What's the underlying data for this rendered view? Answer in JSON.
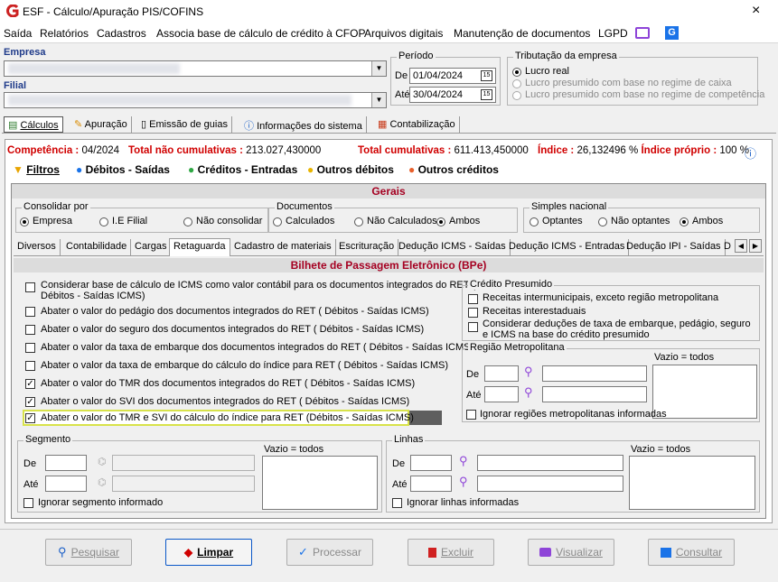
{
  "window": {
    "title": "ESF - Cálculo/Apuração PIS/COFINS",
    "close_glyph": "×"
  },
  "menu": [
    "Saída",
    "Relatórios",
    "Cadastros",
    "Associa base de cálculo de crédito à CFOP",
    "Arquivos digitais",
    "Manutenção de documentos",
    "LGPD"
  ],
  "empresa": {
    "label": "Empresa",
    "value": ""
  },
  "filial": {
    "label": "Filial",
    "value": ""
  },
  "periodo": {
    "title": "Período",
    "de_label": "De",
    "de_value": "01/04/2024",
    "ate_label": "Até",
    "ate_value": "30/04/2024",
    "cal_glyph": "15"
  },
  "tributacao": {
    "title": "Tributação da empresa",
    "options": [
      "Lucro real",
      "Lucro presumido com base no regime de caixa",
      "Lucro presumido com base no regime de competência"
    ],
    "selected": 0
  },
  "main_tabs": [
    "Cálculos",
    "Apuração",
    "Emissão de guias",
    "Informações do sistema",
    "Contabilização"
  ],
  "summary": {
    "competencia_label": "Competência :",
    "competencia_value": "04/2024",
    "nao_cum_label": "Total não cumulativas :",
    "nao_cum_value": "213.027,430000",
    "cum_label": "Total cumulativas :",
    "cum_value": "611.413,450000",
    "indice_label": "Índice :",
    "indice_value": "26,132496 %",
    "indice_proprio_label": "Índice próprio :",
    "indice_proprio_value": "100 %"
  },
  "sub_tabs": [
    "Filtros",
    "Débitos - Saídas",
    "Créditos - Entradas",
    "Outros débitos",
    "Outros créditos"
  ],
  "gerais": {
    "title": "Gerais",
    "consolidar": {
      "title": "Consolidar por",
      "options": [
        "Empresa",
        "I.E Filial",
        "Não consolidar"
      ],
      "selected": 0
    },
    "documentos": {
      "title": "Documentos",
      "options": [
        "Calculados",
        "Não Calculados",
        "Ambos"
      ],
      "selected": 2
    },
    "simples": {
      "title": "Simples nacional",
      "options": [
        "Optantes",
        "Não optantes",
        "Ambos"
      ],
      "selected": 2
    }
  },
  "filter_tabs": [
    "Diversos",
    "Contabilidade",
    "Cargas",
    "Retaguarda",
    "Cadastro de materiais",
    "Escrituração",
    "Dedução ICMS - Saídas",
    "Dedução ICMS - Entradas",
    "Dedução IPI - Saídas",
    "D"
  ],
  "bpe": {
    "title": "Bilhete de Passagem Eletrônico (BPe)",
    "options": [
      {
        "label": "Considerar base de cálculo de ICMS como valor contábil para os documentos integrados do RET (",
        "label2": "Débitos - Saídas ICMS)",
        "checked": false
      },
      {
        "label": "Abater o valor do pedágio dos documentos integrados do RET ( Débitos - Saídas ICMS)",
        "checked": false
      },
      {
        "label": "Abater o valor do seguro dos documentos integrados do RET ( Débitos - Saídas ICMS)",
        "checked": false
      },
      {
        "label": "Abater o valor da taxa de embarque dos documentos integrados do RET ( Débitos - Saídas ICMS)",
        "checked": false
      },
      {
        "label": "Abater o valor da taxa de embarque do cálculo do índice para RET ( Débitos - Saídas ICMS)",
        "checked": false
      },
      {
        "label": "Abater o valor do TMR dos documentos integrados do RET ( Débitos - Saídas ICMS)",
        "checked": true
      },
      {
        "label": "Abater o valor do SVI dos documentos integrados do RET ( Débitos - Saídas ICMS)",
        "checked": true
      },
      {
        "label": "Abater o valor do TMR e SVI do cálculo do índice para RET (Débitos - Saídas ICMS)",
        "checked": true
      }
    ]
  },
  "credito_presumido": {
    "title": "Crédito Presumido",
    "options": [
      {
        "label": "Receitas intermunicipais, exceto região metropolitana",
        "checked": false
      },
      {
        "label": "Receitas interestaduais",
        "checked": false
      },
      {
        "label": "Considerar deduções de taxa de embarque, pedágio, seguro",
        "label2": "e ICMS na base do crédito presumido",
        "checked": false
      }
    ]
  },
  "regiao": {
    "title": "Região Metropolitana",
    "vazio": "Vazio = todos",
    "de_label": "De",
    "ate_label": "Até",
    "ignorar": "Ignorar regiões metropolitanas informadas"
  },
  "segmento": {
    "title": "Segmento",
    "vazio": "Vazio = todos",
    "de_label": "De",
    "ate_label": "Até",
    "ignorar": "Ignorar segmento informado"
  },
  "linhas": {
    "title": "Linhas",
    "vazio": "Vazio = todos",
    "de_label": "De",
    "ate_label": "Até",
    "ignorar": "Ignorar linhas informadas"
  },
  "buttons": [
    "Pesquisar",
    "Limpar",
    "Processar",
    "Excluir",
    "Visualizar",
    "Consultar"
  ],
  "colors": {
    "accent_red": "#d00000",
    "header_red": "#a50021",
    "highlight": "#f6f6b0",
    "primary_blue": "#0a57c8",
    "app_red": "#cc2222"
  }
}
